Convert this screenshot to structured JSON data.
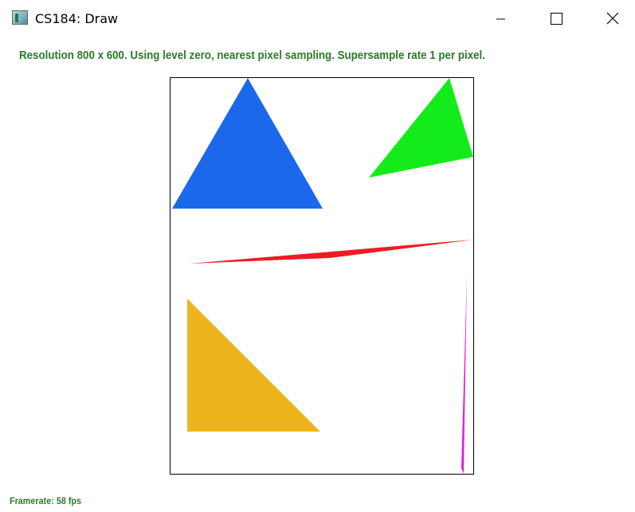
{
  "window": {
    "title": "CS184: Draw"
  },
  "status": {
    "text": "Resolution 800 x 600. Using level zero, nearest pixel sampling. Supersample rate 1 per pixel.",
    "color": "#2b7a2b"
  },
  "framerate": {
    "text": "Framerate: 58 fps"
  },
  "canvas": {
    "shapes": [
      {
        "name": "blue-triangle",
        "color": "#1b69ea"
      },
      {
        "name": "green-triangle",
        "color": "#13ec1a"
      },
      {
        "name": "red-sliver-triangle",
        "color": "#ee1b24"
      },
      {
        "name": "orange-triangle",
        "color": "#edb51d"
      },
      {
        "name": "magenta-sliver-triangle",
        "color": "#e11ee6"
      }
    ]
  }
}
